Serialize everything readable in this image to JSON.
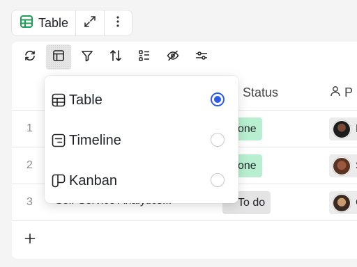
{
  "tab": {
    "label": "Table"
  },
  "colors": {
    "accent": "#2f5bea",
    "table_icon": "#1f9d55",
    "status_done": "#b8efd0",
    "status_todo": "#e4e4e4"
  },
  "toolbar": {
    "tools": [
      "refresh-icon",
      "layout-icon",
      "filter-icon",
      "sort-icon",
      "fields-icon",
      "hide-icon",
      "settings-sliders-icon"
    ]
  },
  "header": {
    "status": "Status",
    "person_prefix": "P"
  },
  "rows": [
    {
      "num": "1",
      "name": "",
      "status": "one",
      "initial": "E"
    },
    {
      "num": "2",
      "name": "",
      "status": "one",
      "initial": "S"
    },
    {
      "num": "3",
      "name": "Self-Service Analytics...",
      "status": "To do",
      "initial": "C"
    }
  ],
  "dropdown": {
    "options": [
      {
        "label": "Table",
        "icon": "table-icon",
        "selected": true
      },
      {
        "label": "Timeline",
        "icon": "timeline-icon",
        "selected": false
      },
      {
        "label": "Kanban",
        "icon": "kanban-icon",
        "selected": false
      }
    ]
  },
  "add_row": {
    "icon": "plus-icon"
  }
}
